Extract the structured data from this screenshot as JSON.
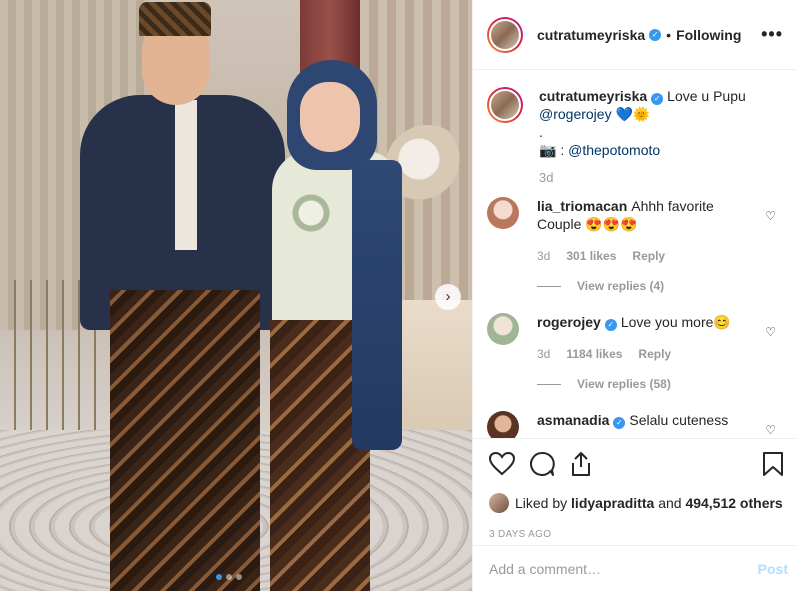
{
  "post": {
    "image_alt": "Couple in traditional Javanese batik attire",
    "carousel_active_index": 0,
    "carousel_count": 3
  },
  "header": {
    "username": "cutratumeyriska",
    "separator": "•",
    "follow_label": "Following",
    "more_label": "•••"
  },
  "caption": {
    "username": "cutratumeyriska",
    "text": "Love u Pupu",
    "mention": "@rogerojey",
    "emojis": "💙🌞",
    "dot_line": ".",
    "camera": "📷",
    "credit_prefix": ":",
    "credit_mention": "@thepotomoto",
    "time": "3d"
  },
  "comments": [
    {
      "username": "lia_triomacan",
      "verified": false,
      "text": "Ahhh favorite Couple 😍😍😍",
      "time": "3d",
      "likes": "301 likes",
      "reply_label": "Reply",
      "view_replies": "View replies (4)",
      "avatar_color": "#e4c4b4"
    },
    {
      "username": "rogerojey",
      "verified": true,
      "text": "Love you more😊",
      "time": "3d",
      "likes": "1184 likes",
      "reply_label": "Reply",
      "view_replies": "View replies (58)",
      "avatar_color": "#cfd8c8"
    },
    {
      "username": "asmanadia",
      "verified": true,
      "text": "Selalu cuteness",
      "avatar_color": "#8a5a3a"
    }
  ],
  "likes": {
    "prefix": "Liked by",
    "user": "lidyapraditta",
    "joiner": "and",
    "count": "494,512 others"
  },
  "timestamp": "3 DAYS AGO",
  "add_comment": {
    "placeholder": "Add a comment…",
    "post_label": "Post"
  },
  "icons": {
    "like": "heart-icon",
    "comment": "comment-icon",
    "share": "share-icon",
    "save": "bookmark-icon",
    "next": "chevron-right-icon",
    "verified": "verified-badge-icon"
  },
  "colors": {
    "verified": "#3897f0",
    "mention": "#003569",
    "post_disabled": "#b2dffc",
    "muted": "#999999",
    "carousel_active": "#3897f0"
  }
}
